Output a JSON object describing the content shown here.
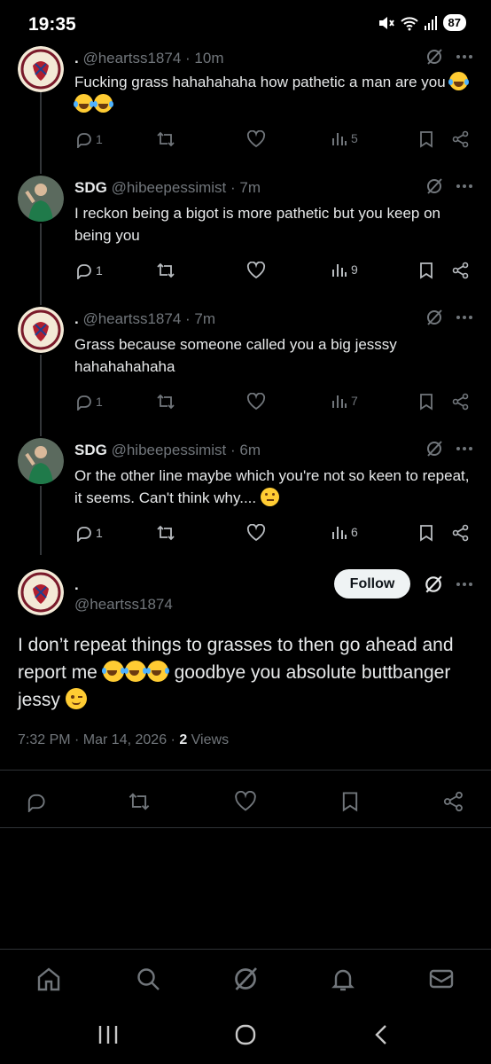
{
  "status": {
    "time": "19:35",
    "battery": "87"
  },
  "tweets": [
    {
      "name": ".",
      "handle": "@heartss1874",
      "time": "10m",
      "text": "Fucking grass hahahahaha how pathetic a man are you",
      "replies": "1",
      "views": "5"
    },
    {
      "name": "SDG",
      "handle": "@hibeepessimist",
      "time": "7m",
      "text": "I reckon being a bigot is more pathetic but you keep on being you",
      "replies": "1",
      "views": "9"
    },
    {
      "name": ".",
      "handle": "@heartss1874",
      "time": "7m",
      "text": "Grass because someone called you a big jesssy hahahahahaha",
      "replies": "1",
      "views": "7"
    },
    {
      "name": "SDG",
      "handle": "@hibeepessimist",
      "time": "6m",
      "text": "Or the other line maybe which you're not so keen to repeat, it seems. Can't think why....",
      "replies": "1",
      "views": "6"
    }
  ],
  "main_tweet": {
    "name": ".",
    "handle": "@heartss1874",
    "follow_label": "Follow",
    "text_part1": "I don’t repeat things to grasses to then go ahead and report me",
    "text_part2": "goodbye you absolute buttbanger jessy",
    "timestamp": "7:32 PM · Mar 14, 2026 · ",
    "views_count": "2",
    "views_label": "Views"
  },
  "colors": {
    "background": "#000000",
    "text": "#e7e9ea",
    "muted": "#71767b",
    "divider": "#2f3336"
  },
  "icons": [
    "home-icon",
    "search-icon",
    "grok-icon",
    "notifications-icon",
    "messages-icon"
  ]
}
